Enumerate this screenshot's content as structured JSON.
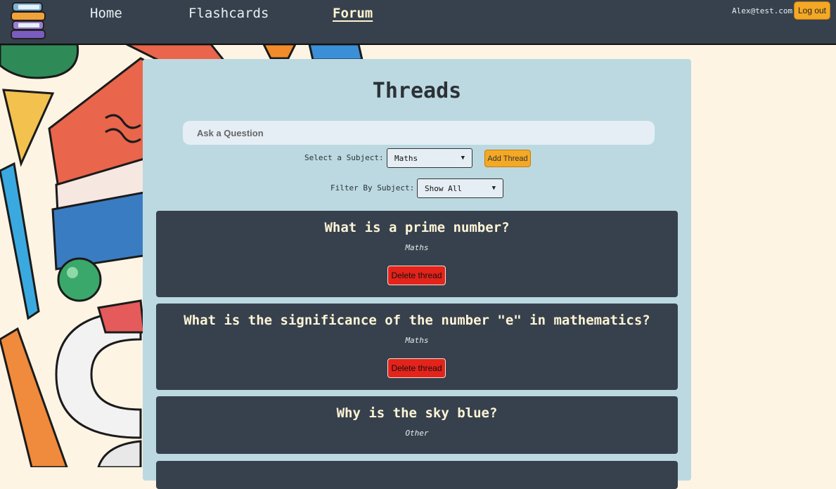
{
  "nav": {
    "links": [
      {
        "label": "Home",
        "active": false
      },
      {
        "label": "Flashcards",
        "active": false
      },
      {
        "label": "Forum",
        "active": true
      }
    ],
    "user_email": "Alex@test.com",
    "logout_label": "Log out"
  },
  "page": {
    "title": "Threads",
    "ask_placeholder": "Ask a Question",
    "select_subject_label": "Select a Subject:",
    "select_subject_value": "Maths",
    "add_thread_label": "Add Thread",
    "filter_label": "Filter By Subject:",
    "filter_value": "Show All"
  },
  "threads": [
    {
      "title": "What is a prime number?",
      "subject": "Maths",
      "delete_label": "Delete thread"
    },
    {
      "title": "What is the significance of the number \"e\" in mathematics?",
      "subject": "Maths",
      "delete_label": "Delete thread"
    },
    {
      "title": "Why is the sky blue?",
      "subject": "Other"
    }
  ],
  "colors": {
    "navbar": "#37414d",
    "panel": "#bcd9e1",
    "accent": "#f4a825",
    "danger": "#e4231b",
    "page_bg": "#fdf4e4"
  }
}
